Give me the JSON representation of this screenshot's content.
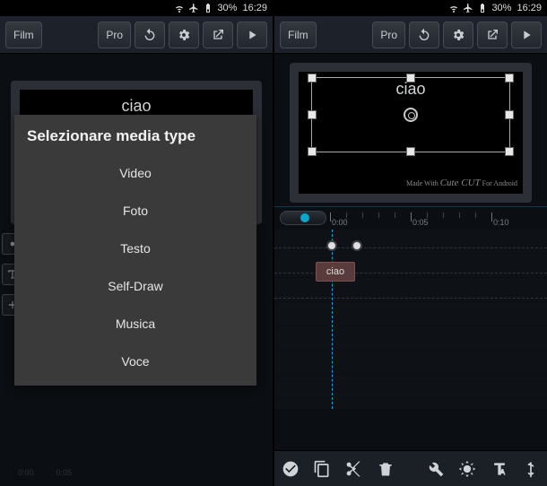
{
  "status": {
    "battery": "30%",
    "time": "16:29"
  },
  "toolbar": {
    "film": "Film",
    "pro": "Pro"
  },
  "preview": {
    "text": "ciao",
    "watermark_made": "Made With",
    "watermark_brand": "Cute CUT",
    "watermark_for": "For Android"
  },
  "dialog": {
    "title": "Selezionare media type",
    "options": [
      "Video",
      "Foto",
      "Testo",
      "Self-Draw",
      "Musica",
      "Voce"
    ]
  },
  "timeline": {
    "ticks": [
      "0:00",
      "0:05",
      "0:10"
    ],
    "clip_label": "ciao"
  }
}
